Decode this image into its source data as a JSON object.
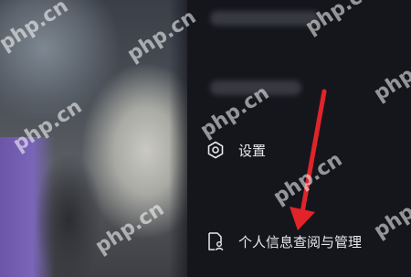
{
  "menu": {
    "items": [
      {
        "label": "设置",
        "icon": "hexagon-gear-icon"
      },
      {
        "label": "个人信息查阅与管理",
        "icon": "document-person-icon"
      }
    ]
  },
  "watermark": {
    "text": "php.cn"
  },
  "annotation": {
    "color": "#e0242a"
  }
}
